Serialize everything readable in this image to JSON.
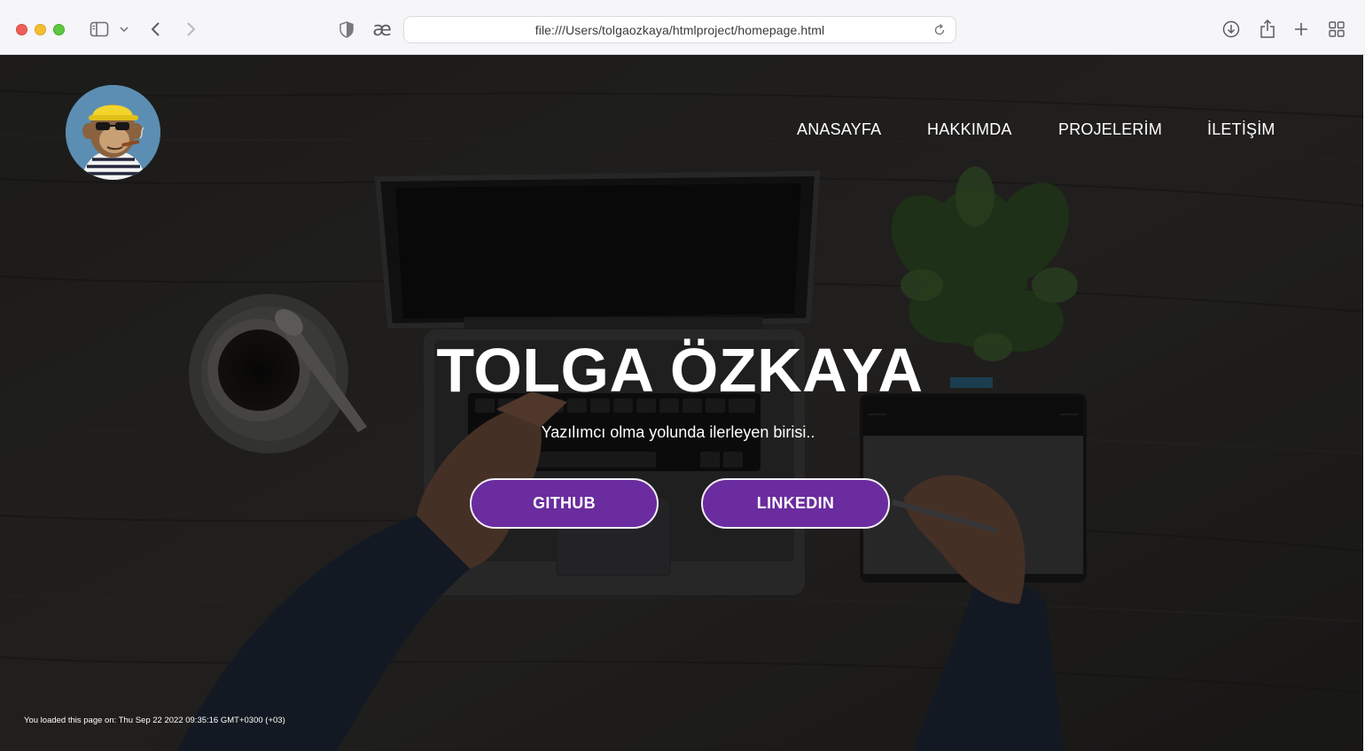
{
  "browser": {
    "url": "file:///Users/tolgaozkaya/htmlproject/homepage.html",
    "reader_icon": "æ"
  },
  "nav": {
    "items": [
      {
        "label": "ANASAYFA"
      },
      {
        "label": "HAKKIMDA"
      },
      {
        "label": "PROJELERİM"
      },
      {
        "label": "İLETİŞİM"
      }
    ]
  },
  "hero": {
    "title": "TOLGA ÖZKAYA",
    "subtitle": "Yazılımcı olma yolunda ilerleyen birisi..",
    "buttons": {
      "github": "GITHUB",
      "linkedin": "LINKEDIN"
    }
  },
  "footer": {
    "loaded_text": "You loaded this page on: Thu Sep 22 2022 09:35:16 GMT+0300 (+03)"
  },
  "colors": {
    "button_bg": "#6a2c9e",
    "button_border": "#f2eef7",
    "text": "#ffffff"
  }
}
